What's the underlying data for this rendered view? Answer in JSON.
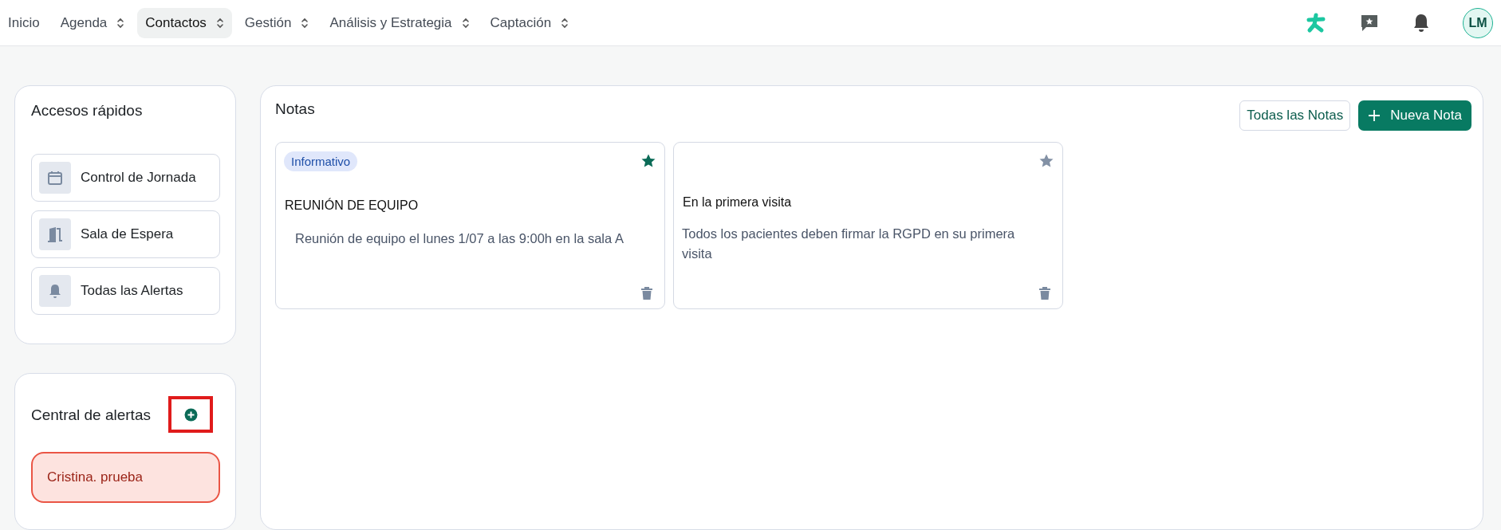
{
  "nav": {
    "items": [
      {
        "label": "Inicio",
        "dropdown": false,
        "selected": false
      },
      {
        "label": "Agenda",
        "dropdown": true,
        "selected": false
      },
      {
        "label": "Contactos",
        "dropdown": true,
        "selected": true
      },
      {
        "label": "Gestión",
        "dropdown": true,
        "selected": false
      },
      {
        "label": "Análisis y Estrategia",
        "dropdown": true,
        "selected": false
      },
      {
        "label": "Captación",
        "dropdown": true,
        "selected": false
      }
    ],
    "avatar": "LM"
  },
  "quick_access": {
    "title": "Accesos rápidos",
    "items": [
      {
        "label": "Control de Jornada",
        "kind": "calendar"
      },
      {
        "label": "Sala de Espera",
        "kind": "door"
      },
      {
        "label": "Todas las Alertas",
        "kind": "bell"
      }
    ]
  },
  "alerts": {
    "title": "Central de alertas",
    "items": [
      {
        "label": "Cristina. prueba"
      }
    ]
  },
  "notes": {
    "title": "Notas",
    "buttons": {
      "all": "Todas las Notas",
      "new": "Nueva Nota"
    },
    "items": [
      {
        "tag": "Informativo",
        "starred": true,
        "title": "REUNIÓN DE EQUIPO",
        "body": "Reunión de equipo el lunes 1/07 a las 9:00h en la sala A"
      },
      {
        "starred": false,
        "title": "En la primera visita",
        "body": "Todos los pacientes deben firmar la RGPD en su primera visita"
      }
    ]
  }
}
